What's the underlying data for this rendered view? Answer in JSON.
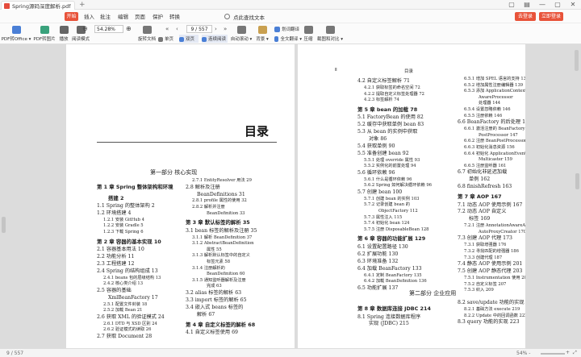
{
  "window": {
    "tab_title": "Spring源码深度解析.pdf",
    "new_tab": "+",
    "controls": [
      "▢",
      "▤",
      "—",
      "▢",
      "✕"
    ]
  },
  "menu": {
    "start": "开始",
    "items": [
      "插入",
      "批注",
      "编辑",
      "页面",
      "保护",
      "转换"
    ],
    "search": "点此查找文本",
    "right_buttons": [
      "去登录",
      "立即登录"
    ]
  },
  "toolbar": {
    "items": [
      {
        "label": "PDF转Office ▾",
        "icon": "pdf-to-office-icon"
      },
      {
        "label": "PDF转图片",
        "icon": "pdf-to-image-icon"
      },
      {
        "label": "播放",
        "icon": "play-icon"
      },
      {
        "label": "阅读模式",
        "icon": "reading-mode-icon"
      },
      {
        "label": "旋转文档",
        "icon": "rotate-icon"
      },
      {
        "label": "单页",
        "icon": "single-page-icon"
      },
      {
        "label": "双页",
        "icon": "double-page-icon"
      },
      {
        "label": "连续阅读",
        "icon": "continuous-icon"
      },
      {
        "label": "自动滚动 ▾",
        "icon": "auto-scroll-icon"
      },
      {
        "label": "背景 ▾",
        "icon": "background-icon"
      },
      {
        "label": "划词翻译",
        "icon": "translate-word-icon"
      },
      {
        "label": "全文翻译 ▾",
        "icon": "translate-full-icon"
      },
      {
        "label": "压缩",
        "icon": "compress-icon"
      },
      {
        "label": "截图和对比 ▾",
        "icon": "screenshot-icon"
      }
    ],
    "zoom_value": "54.28%",
    "zoom_out": "⊖",
    "zoom_in": "⊕",
    "page_value": "9 / 557",
    "prev": "‹",
    "next": "›",
    "first": "«",
    "last": "»"
  },
  "statusbar": {
    "page": "9 / 557",
    "zoom": "54% -",
    "plus": "+",
    "fit": "⤢"
  },
  "left_page": {
    "title": "目录",
    "part1": "第一部分  核心实现",
    "col1": [
      {
        "t": "第 1 章  Spring 整体架构和环境",
        "lv": 1
      },
      {
        "t": "搭建  2",
        "lv": 1,
        "indent": 14
      },
      {
        "t": "1.1  Spring 的整体架构  2",
        "lv": 2
      },
      {
        "t": "1.2  环境搭建  4",
        "lv": 2
      },
      {
        "t": "1.2.1  安装 GitHub  4",
        "lv": 3
      },
      {
        "t": "1.2.2  安装 Gradle  5",
        "lv": 3
      },
      {
        "t": "1.2.3  下载 Spring  6",
        "lv": 3
      },
      {
        "t": "第 2 章  容器的基本实现  10",
        "lv": 1
      },
      {
        "t": "2.1  容器基本用法  10",
        "lv": 2
      },
      {
        "t": "2.2  功能分析  11",
        "lv": 2
      },
      {
        "t": "2.3  工程搭建  12",
        "lv": 2
      },
      {
        "t": "2.4  Spring 的结构组成  13",
        "lv": 2
      },
      {
        "t": "2.4.1  beans 包的层级结构  13",
        "lv": 3
      },
      {
        "t": "2.4.2  核心类介绍  13",
        "lv": 3
      },
      {
        "t": "2.5  容器的基础",
        "lv": 2
      },
      {
        "t": "XmlBeanFactory  17",
        "lv": 2,
        "indent": 14
      },
      {
        "t": "2.5.1  配置文件封装  18",
        "lv": 3
      },
      {
        "t": "2.5.2  加载 Bean  21",
        "lv": 3
      },
      {
        "t": "2.6  获取 XML 的验证模式  24",
        "lv": 2
      },
      {
        "t": "2.6.1  DTD 与 XSD 区别  24",
        "lv": 3
      },
      {
        "t": "2.6.2  验证模式的读取  26",
        "lv": 3
      },
      {
        "t": "2.7  获取 Document  28",
        "lv": 2
      }
    ],
    "col2": [
      {
        "t": "2.7.1  EntityResolver 用法  29",
        "lv": 3
      },
      {
        "t": "2.8  解析及注册",
        "lv": 2
      },
      {
        "t": "BeanDefinitions  31",
        "lv": 2,
        "indent": 14
      },
      {
        "t": "2.8.1  profile 属性的使用  32",
        "lv": 3
      },
      {
        "t": "2.8.2  解析并注册",
        "lv": 3
      },
      {
        "t": "BeanDefinition  33",
        "lv": 3,
        "indent": 18
      },
      {
        "t": "第 3 章  默认标签的解析  35",
        "lv": 1
      },
      {
        "t": "3.1  bean 标签的解析及注册  35",
        "lv": 2
      },
      {
        "t": "3.1.1  解析 BeanDefinition  37",
        "lv": 3
      },
      {
        "t": "3.1.2  AbstractBeanDefinition",
        "lv": 3
      },
      {
        "t": "属性  55",
        "lv": 3,
        "indent": 18
      },
      {
        "t": "3.1.3  解析默认标签中的自定义",
        "lv": 3
      },
      {
        "t": "标签元素  58",
        "lv": 3,
        "indent": 18
      },
      {
        "t": "3.1.4  注册解析的",
        "lv": 3
      },
      {
        "t": "BeanDefinition  60",
        "lv": 3,
        "indent": 18
      },
      {
        "t": "3.1.5  通知监听器解析及注册",
        "lv": 3
      },
      {
        "t": "完成  63",
        "lv": 3,
        "indent": 18
      },
      {
        "t": "3.2  alias 标签的解析  63",
        "lv": 2
      },
      {
        "t": "3.3  import 标签的解析  65",
        "lv": 2
      },
      {
        "t": "3.4  嵌入式 beans 标签的",
        "lv": 2
      },
      {
        "t": "解析  67",
        "lv": 2,
        "indent": 14
      },
      {
        "t": "第 4 章  自定义标签的解析  68",
        "lv": 1
      },
      {
        "t": "4.1  自定义标签使用  69",
        "lv": 2
      }
    ]
  },
  "right_page": {
    "header_left": "Ⅱ",
    "header_center": "目录",
    "part2": "第二部分  企业应用",
    "col1": [
      {
        "t": "4.2  自定义标签解析  71",
        "lv": 2
      },
      {
        "t": "4.2.1  获取标签的命名空间  72",
        "lv": 3
      },
      {
        "t": "4.2.2  提取自定义标签处理器  72",
        "lv": 3
      },
      {
        "t": "4.2.3  标签解析  74",
        "lv": 3
      },
      {
        "t": "第 5 章  bean 的加载  78",
        "lv": 1
      },
      {
        "t": "5.1  FactoryBean 的使用  82",
        "lv": 2
      },
      {
        "t": "5.2  缓存中获取单例 bean  83",
        "lv": 2
      },
      {
        "t": "5.3  从 bean 的实例中获取",
        "lv": 2
      },
      {
        "t": "对象  86",
        "lv": 2,
        "indent": 14
      },
      {
        "t": "5.4  获取单例  90",
        "lv": 2
      },
      {
        "t": "5.5  准备创建 bean  92",
        "lv": 2
      },
      {
        "t": "5.5.1  处理 override 属性  93",
        "lv": 3
      },
      {
        "t": "5.5.2  实例化的前置处理  94",
        "lv": 3
      },
      {
        "t": "5.6  循环依赖  96",
        "lv": 2
      },
      {
        "t": "5.6.1  什么是循环依赖  96",
        "lv": 3
      },
      {
        "t": "5.6.2  Spring 如何解决循环依赖  96",
        "lv": 3
      },
      {
        "t": "5.7  创建 bean  100",
        "lv": 2
      },
      {
        "t": "5.7.1  创建 bean 的实例  103",
        "lv": 3
      },
      {
        "t": "5.7.2  记录创建 bean 的",
        "lv": 3
      },
      {
        "t": "ObjectFactory  112",
        "lv": 3,
        "indent": 18
      },
      {
        "t": "5.7.3  属性注入  115",
        "lv": 3
      },
      {
        "t": "5.7.4  初始化 bean  124",
        "lv": 3
      },
      {
        "t": "5.7.5  注册 DisposableBean  128",
        "lv": 3
      },
      {
        "t": "第 6 章  容器的功能扩展  129",
        "lv": 1
      },
      {
        "t": "6.1  设置配置路径  130",
        "lv": 2
      },
      {
        "t": "6.2  扩展功能  130",
        "lv": 2
      },
      {
        "t": "6.3  环境准备  132",
        "lv": 2
      },
      {
        "t": "6.4  加载 BeanFactory  133",
        "lv": 2
      },
      {
        "t": "6.4.1  定制 BeanFactory  135",
        "lv": 3
      },
      {
        "t": "6.4.2  加载 BeanDefinition  136",
        "lv": 3
      },
      {
        "t": "6.5  功能扩展  137",
        "lv": 2
      }
    ],
    "col1_after_part": [
      {
        "t": "第 8 章  数据库连接 JDBC  214",
        "lv": 1
      },
      {
        "t": "8.1  Spring 连接数据库程序",
        "lv": 2
      },
      {
        "t": "实现 (JDBC)  215",
        "lv": 2,
        "indent": 14
      }
    ],
    "col2": [
      {
        "t": "6.5.1  增加 SPEL 语言的支持  138",
        "lv": 3
      },
      {
        "t": "6.5.2  增加属性注册编辑器  139",
        "lv": 3
      },
      {
        "t": "6.5.3  添加 ApplicationContext",
        "lv": 3
      },
      {
        "t": "AwareProcessor",
        "lv": 3,
        "indent": 18
      },
      {
        "t": "处理器  144",
        "lv": 3,
        "indent": 18
      },
      {
        "t": "6.5.4  设置忽略依赖  146",
        "lv": 3
      },
      {
        "t": "6.5.5  注册依赖  146",
        "lv": 3
      },
      {
        "t": "6.6  BeanFactory 的后处理  146",
        "lv": 2
      },
      {
        "t": "6.6.1  激活注册的 BeanFactory",
        "lv": 3
      },
      {
        "t": "PostProcessor  147",
        "lv": 3,
        "indent": 18
      },
      {
        "t": "6.6.2  注册 BeanPostProcessor  153",
        "lv": 3
      },
      {
        "t": "6.6.3  初始化消息资源  156",
        "lv": 3
      },
      {
        "t": "6.6.4  初始化 ApplicationEvent",
        "lv": 3
      },
      {
        "t": "Multicaster  159",
        "lv": 3,
        "indent": 18
      },
      {
        "t": "6.6.5  注册监听器  161",
        "lv": 3
      },
      {
        "t": "6.7  初始化非延迟加载",
        "lv": 2
      },
      {
        "t": "单例  162",
        "lv": 2,
        "indent": 14
      },
      {
        "t": "6.8  finishRefresh  163",
        "lv": 2
      },
      {
        "t": "第 7 章  AOP  167",
        "lv": 1
      },
      {
        "t": "7.1  动态 AOP 使用示例  167",
        "lv": 2
      },
      {
        "t": "7.2  动态 AOP 自定义",
        "lv": 2
      },
      {
        "t": "标签  169",
        "lv": 2,
        "indent": 14
      },
      {
        "t": "7.2.1  注册 AnnotationAwareAspectJ",
        "lv": 3
      },
      {
        "t": "AutoProxyCreator  170",
        "lv": 3,
        "indent": 18
      },
      {
        "t": "7.3  创建 AOP 代理  173",
        "lv": 2
      },
      {
        "t": "7.3.1  获取增强器  176",
        "lv": 3
      },
      {
        "t": "7.3.2  寻找匹配的增强器  186",
        "lv": 3
      },
      {
        "t": "7.3.3  创建代理  187",
        "lv": 3
      },
      {
        "t": "7.4  静态 AOP 使用示例  201",
        "lv": 2
      },
      {
        "t": "7.5  创建 AOP 静态代理  203",
        "lv": 2
      },
      {
        "t": "7.5.1  Instrumentation 使用  203",
        "lv": 3
      },
      {
        "t": "7.5.2  自定义标签  207",
        "lv": 3
      },
      {
        "t": "7.5.3  织入  209",
        "lv": 3
      }
    ],
    "col2_after_part": [
      {
        "t": "8.2  save/update 功能的实现  217",
        "lv": 2
      },
      {
        "t": "8.2.1  基础方法 execute  219",
        "lv": 3
      },
      {
        "t": "8.2.2  Update 中的回调函数  222",
        "lv": 3
      },
      {
        "t": "8.3  query 功能的实现  223",
        "lv": 2
      }
    ]
  }
}
